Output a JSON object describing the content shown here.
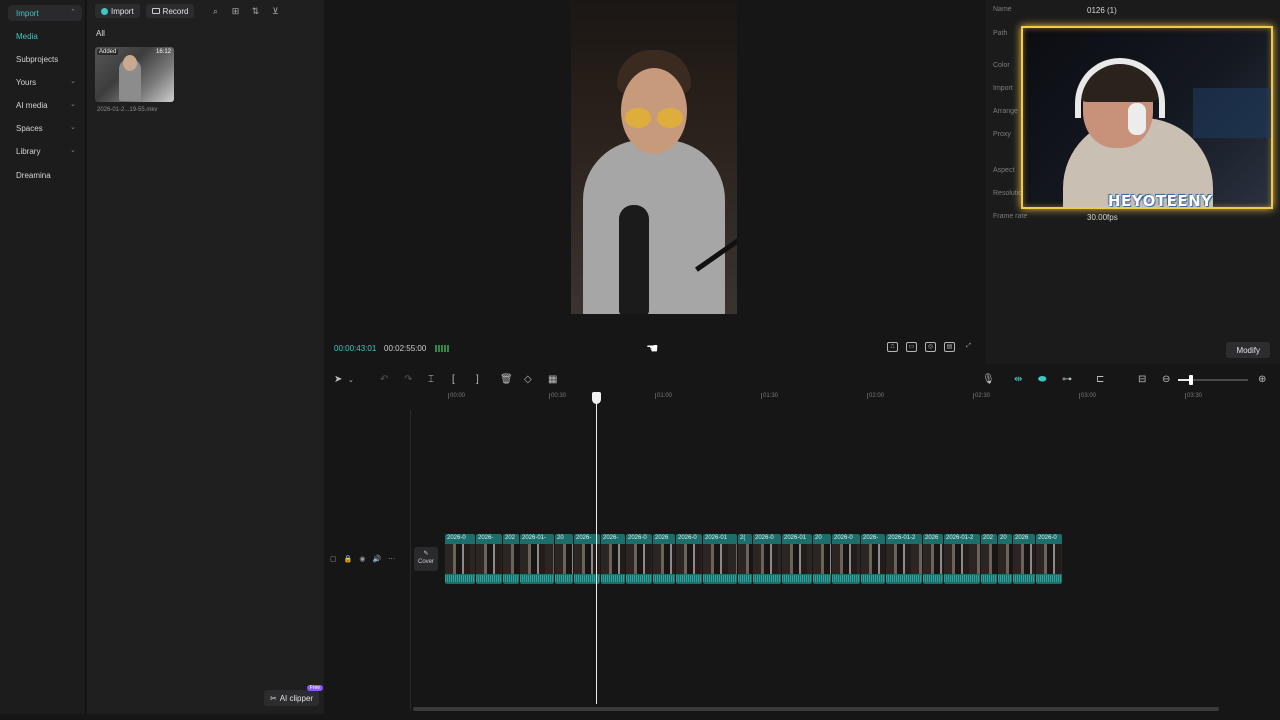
{
  "nav": {
    "items": [
      {
        "label": "Import",
        "chevron": "⌃"
      },
      {
        "label": "Media",
        "chevron": ""
      },
      {
        "label": "Subprojects",
        "chevron": ""
      },
      {
        "label": "Yours",
        "chevron": "⌄"
      },
      {
        "label": "AI media",
        "chevron": "⌄"
      },
      {
        "label": "Spaces",
        "chevron": "⌄"
      },
      {
        "label": "Library",
        "chevron": "⌄"
      },
      {
        "label": "Dreamina",
        "chevron": ""
      }
    ]
  },
  "media": {
    "import_label": "Import",
    "record_label": "Record",
    "filter_tab": "All",
    "item": {
      "badge": "Added",
      "duration": "16:12",
      "filename": "2026-01-2...19-55.mkv"
    },
    "ai_clipper_label": "AI clipper",
    "ai_clipper_badge": "Free"
  },
  "preview": {
    "current_time": "00:00:43:01",
    "total_time": "00:02:55:00"
  },
  "details": {
    "labels": [
      "Name",
      "Path",
      "Color",
      "Import",
      "Arrange",
      "Proxy",
      "Aspect",
      "Resolution",
      "Frame rate"
    ],
    "name_value": "0126 (1)",
    "frame_rate_value": "30.00fps",
    "modify_label": "Modify"
  },
  "webcam": {
    "logo_text": "HEYOTEENY"
  },
  "timeline": {
    "ruler_ticks": [
      "00:00",
      "00:30",
      "01:00",
      "01:30",
      "02:00",
      "02:30",
      "03:00",
      "03:30"
    ],
    "cover_label": "Cover",
    "clips": [
      {
        "label": "2026-0"
      },
      {
        "label": "2026-"
      },
      {
        "label": "202"
      },
      {
        "label": "2026-01-"
      },
      {
        "label": "20"
      },
      {
        "label": "2026-"
      },
      {
        "label": "2026-"
      },
      {
        "label": "2026-0"
      },
      {
        "label": "2026"
      },
      {
        "label": "2026-0"
      },
      {
        "label": "2026-01"
      },
      {
        "label": "2("
      },
      {
        "label": "2026-0"
      },
      {
        "label": "2026-01"
      },
      {
        "label": "20"
      },
      {
        "label": "2026-0"
      },
      {
        "label": "2026-"
      },
      {
        "label": "2026-01-2"
      },
      {
        "label": "2026"
      },
      {
        "label": "2026-01-2"
      },
      {
        "label": "202"
      },
      {
        "label": "20"
      },
      {
        "label": "2026"
      },
      {
        "label": "2026-0"
      }
    ]
  },
  "colors": {
    "accent": "#3fc7c2",
    "webcam_border": "#f2c94c",
    "clip": "#1b6e6a"
  }
}
